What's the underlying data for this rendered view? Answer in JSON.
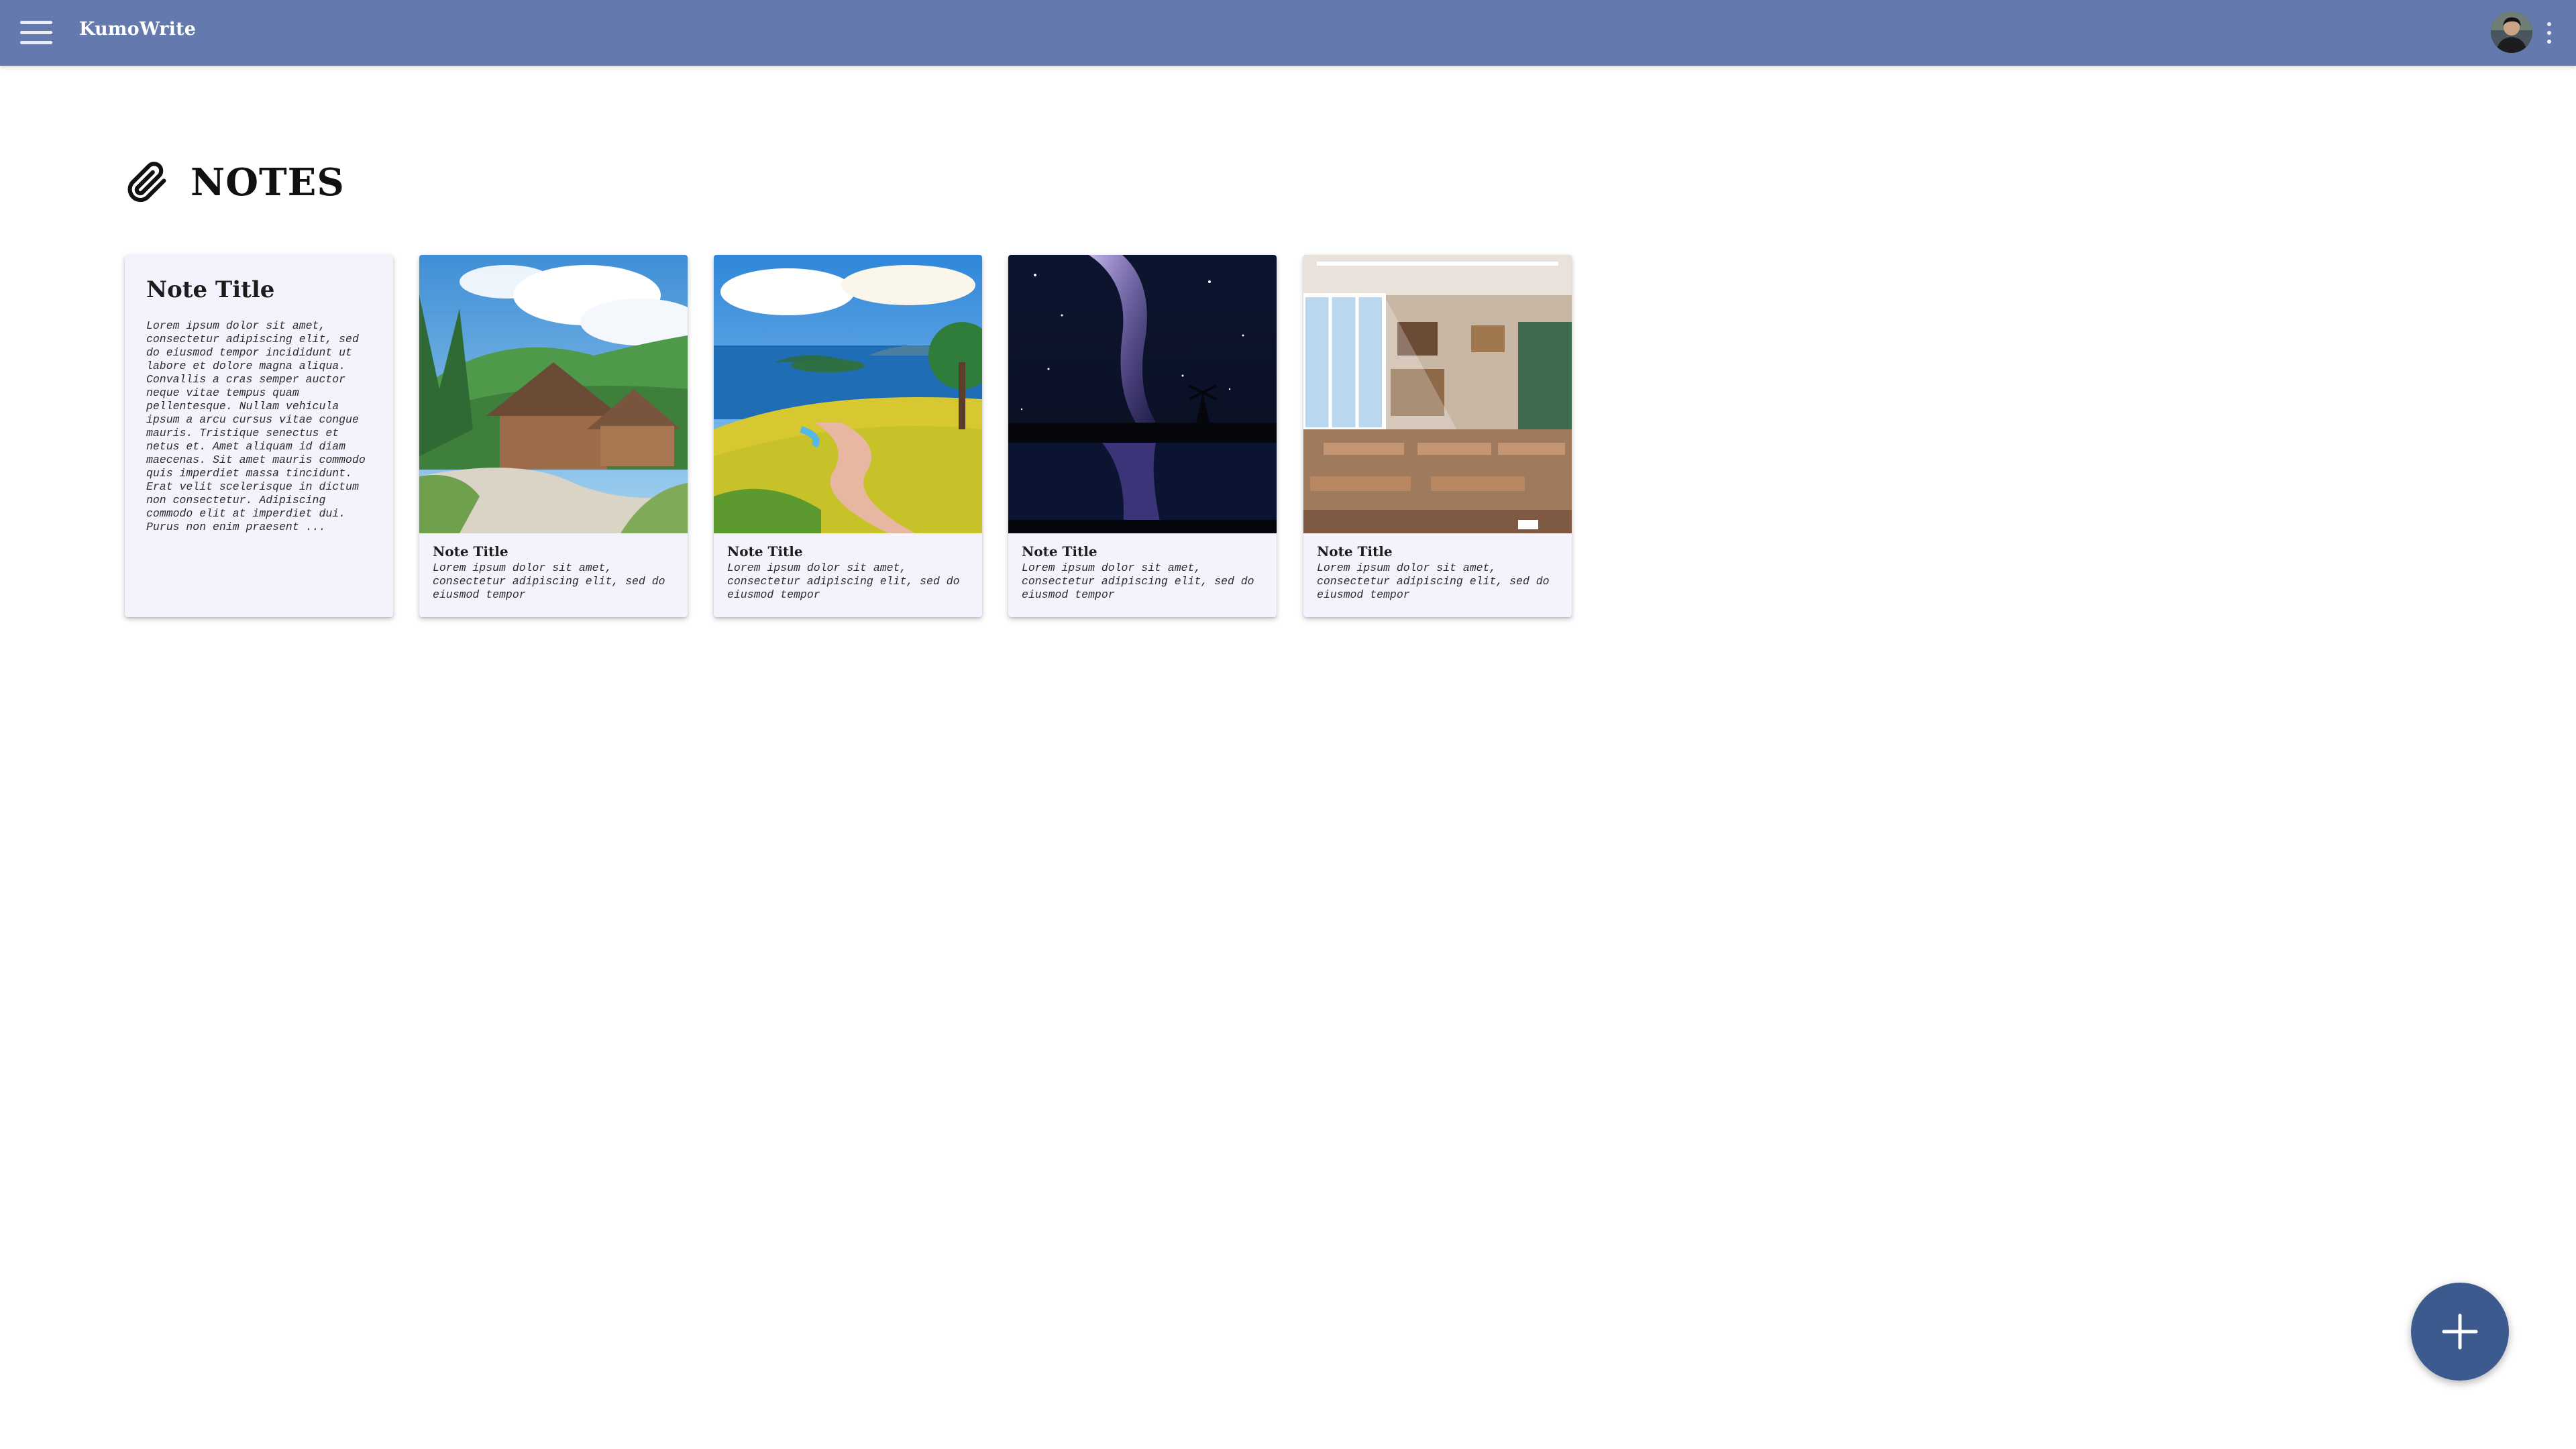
{
  "app": {
    "title": "KumoWrite"
  },
  "header": {
    "menu_icon": "hamburger-menu-icon",
    "avatar_icon": "user-avatar",
    "more_icon": "more-vertical-icon"
  },
  "page": {
    "title": "NOTES",
    "title_icon": "paperclip-icon"
  },
  "notes": [
    {
      "title": "Note Title",
      "body": "Lorem ipsum dolor sit amet, consectetur adipiscing elit, sed do eiusmod tempor incididunt ut labore et dolore magna aliqua. Convallis a cras semper auctor neque vitae tempus quam pellentesque. Nullam vehicula ipsum a arcu cursus vitae congue mauris. Tristique senectus et netus et. Amet aliquam id diam maecenas. Sit amet mauris commodo quis imperdiet massa tincidunt. Erat velit scelerisque in dictum non consectetur. Adipiscing commodo elit at imperdiet dui. Purus non enim praesent ..."
    },
    {
      "title": "Note Title",
      "body": "Lorem ipsum dolor sit amet, consectetur adipiscing elit, sed do eiusmod tempor",
      "image": "village-cottages-image"
    },
    {
      "title": "Note Title",
      "body": "Lorem ipsum dolor sit amet, consectetur adipiscing elit, sed do eiusmod tempor",
      "image": "seaside-meadow-image"
    },
    {
      "title": "Note Title",
      "body": "Lorem ipsum dolor sit amet, consectetur adipiscing elit, sed do eiusmod tempor",
      "image": "milky-way-night-image"
    },
    {
      "title": "Note Title",
      "body": "Lorem ipsum dolor sit amet, consectetur adipiscing elit, sed do eiusmod tempor",
      "image": "classroom-image"
    }
  ],
  "fab": {
    "icon": "plus-icon"
  },
  "colors": {
    "header": "#6479ae",
    "card": "#f4f3fd",
    "fab": "#3d5a8f"
  }
}
